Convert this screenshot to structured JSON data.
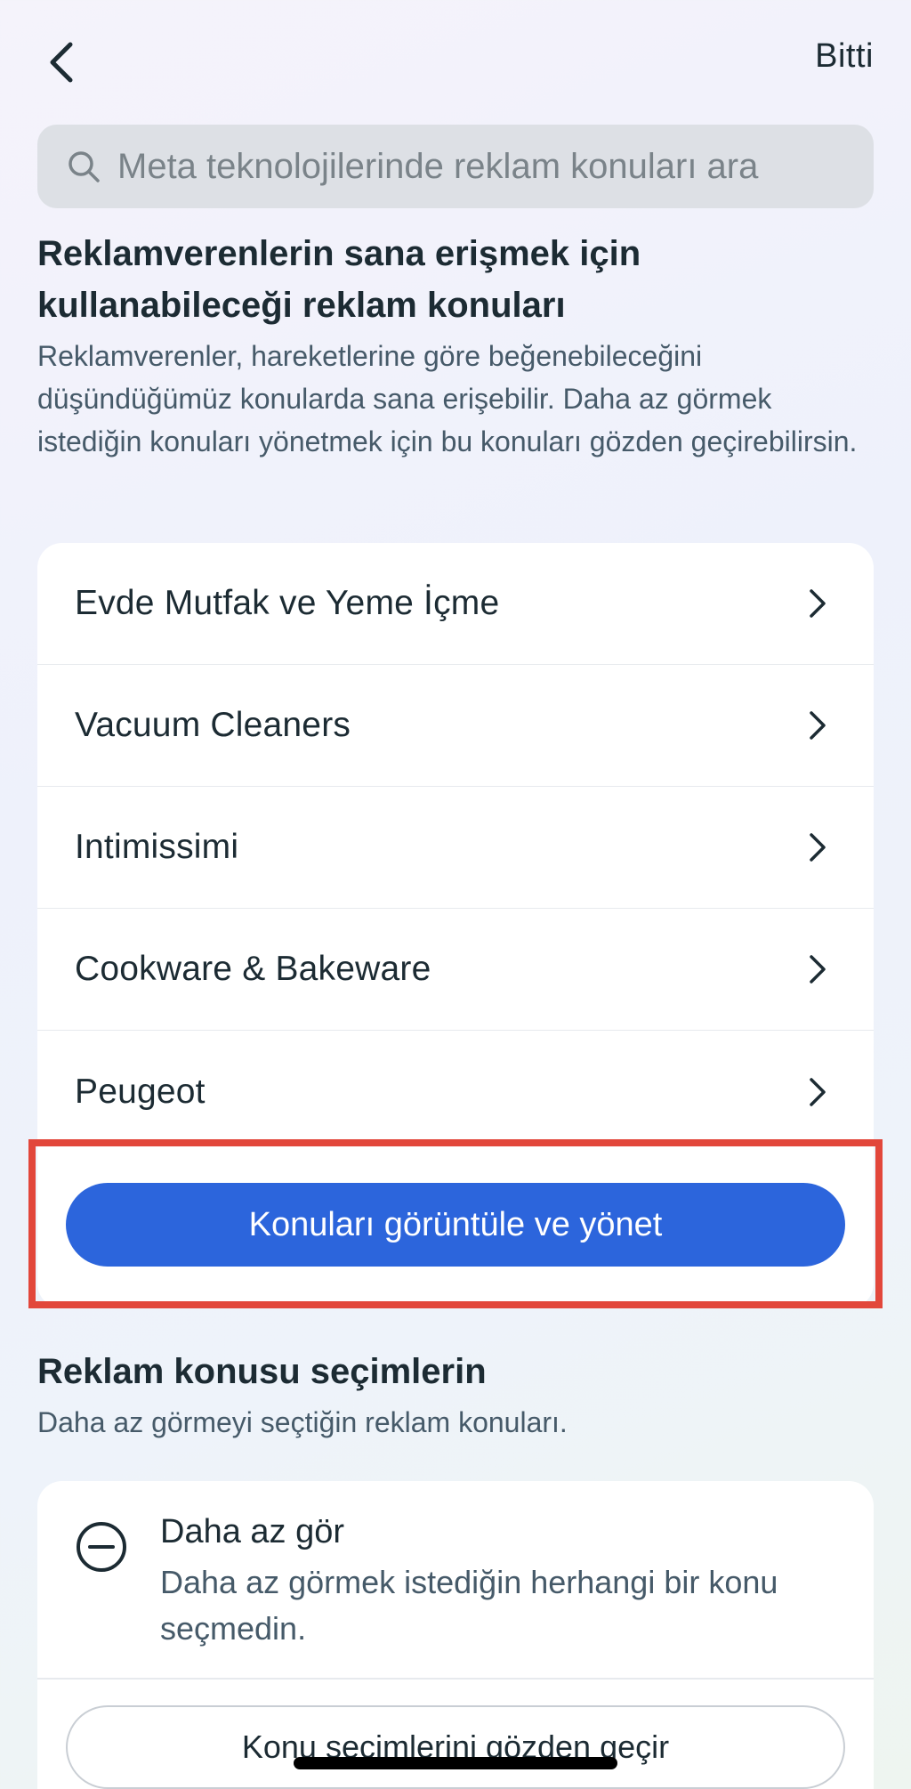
{
  "header": {
    "done_label": "Bitti"
  },
  "search": {
    "placeholder": "Meta teknolojilerinde reklam konuları ara"
  },
  "topics_section": {
    "title": "Reklamverenlerin sana erişmek için kullanabileceği reklam konuları",
    "description": "Reklamverenler, hareketlerine göre beğenebileceğini düşündüğümüz konularda sana erişebilir. Daha az görmek istediğin konuları yönetmek için bu konuları gözden geçirebilirsin.",
    "items": [
      {
        "label": "Evde Mutfak ve Yeme İçme"
      },
      {
        "label": "Vacuum Cleaners"
      },
      {
        "label": "Intimissimi"
      },
      {
        "label": "Cookware & Bakeware"
      },
      {
        "label": "Peugeot"
      }
    ],
    "manage_button_label": "Konuları görüntüle ve yönet"
  },
  "choices_section": {
    "title": "Reklam konusu seçimlerin",
    "description": "Daha az görmeyi seçtiğin reklam konuları.",
    "see_less_title": "Daha az gör",
    "see_less_description": "Daha az görmek istediğin herhangi bir konu seçmedin.",
    "review_button_label": "Konu seçimlerini gözden geçir"
  },
  "colors": {
    "primary_button": "#2c65dc",
    "highlight_border": "#e2473b",
    "text_primary": "#1c2b33",
    "text_secondary": "#465a69"
  },
  "icons": {
    "back": "chevron-left-icon",
    "search": "search-icon",
    "row_arrow": "chevron-right-icon",
    "see_less": "minus-circle-icon"
  }
}
